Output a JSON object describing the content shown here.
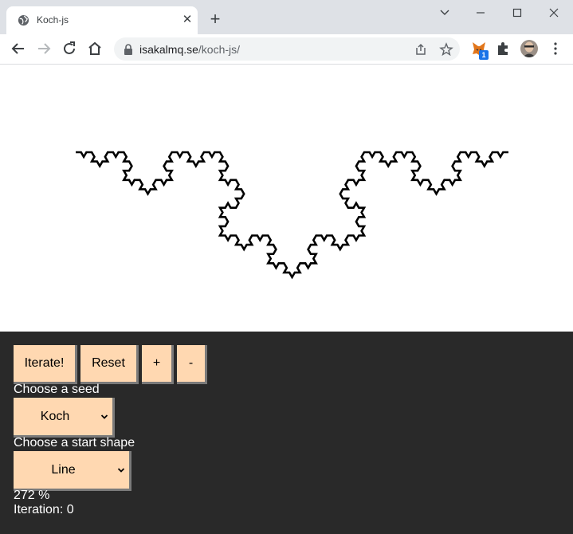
{
  "browser": {
    "tab_title": "Koch-js",
    "url_host": "isakalmq.se",
    "url_path": "/koch-js/",
    "extension_badge": "1"
  },
  "controls": {
    "iterate_label": "Iterate!",
    "reset_label": "Reset",
    "zoom_in_label": "+",
    "zoom_out_label": "-",
    "seed_label": "Choose a seed",
    "seed_value": "Koch",
    "start_shape_label": "Choose a start shape",
    "start_shape_value": "Line",
    "zoom_text": "272 %",
    "iteration_text": "Iteration: 0"
  },
  "colors": {
    "panel_bg": "#292929",
    "button_bg": "#ffd8b1",
    "fractal_stroke": "#000000"
  }
}
